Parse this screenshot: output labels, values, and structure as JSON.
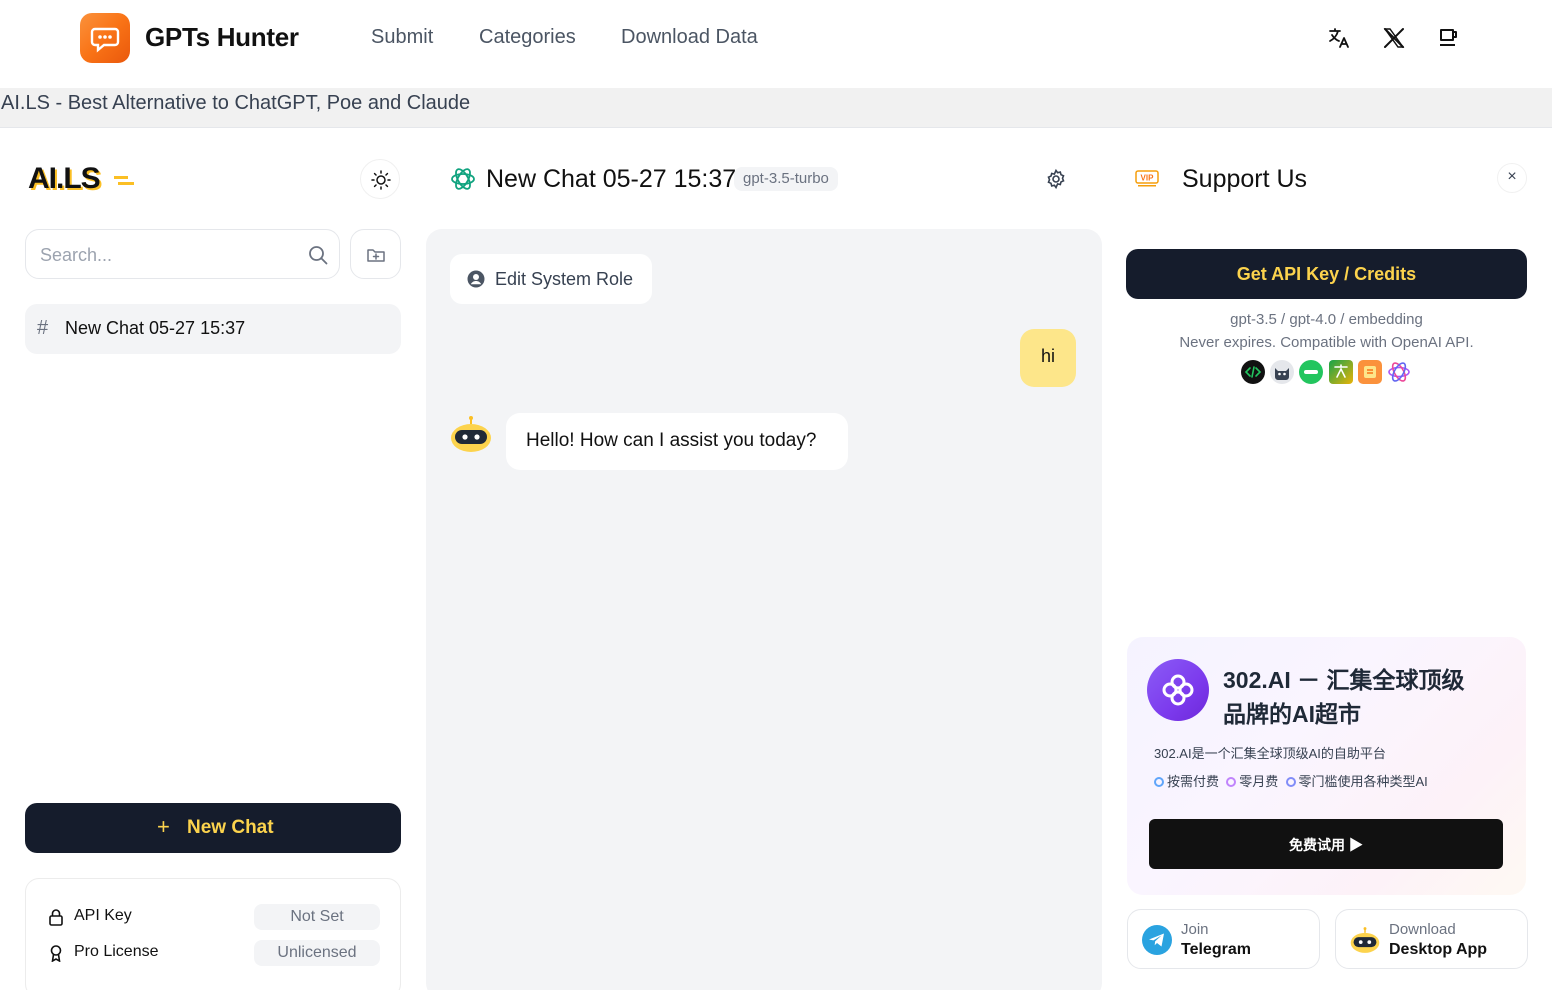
{
  "topnav": {
    "brand": "GPTs Hunter",
    "links": [
      "Submit",
      "Categories",
      "Download Data"
    ],
    "icons": [
      "translate-icon",
      "x-twitter-icon",
      "coffee-icon"
    ]
  },
  "subbar": {
    "title": "AI.LS - Best Alternative to ChatGPT, Poe and Claude"
  },
  "sidebar": {
    "logo": "AI.LS",
    "search": {
      "placeholder": "Search...",
      "value": ""
    },
    "chats": [
      {
        "label": "New Chat 05-27 15:37",
        "prefix": "#"
      }
    ],
    "new_chat_plus": "+",
    "new_chat_label": "New Chat",
    "license": {
      "api_key": {
        "label": "API Key",
        "value": "Not Set"
      },
      "pro_license": {
        "label": "Pro License",
        "value": "Unlicensed"
      }
    }
  },
  "chat": {
    "title": "New Chat 05-27 15:37",
    "model": "gpt-3.5-turbo",
    "system_role_label": "Edit System Role",
    "messages": [
      {
        "role": "user",
        "text": "hi"
      },
      {
        "role": "assistant",
        "text": "Hello! How can I assist you today?"
      }
    ]
  },
  "support": {
    "vip_badge": "VIP",
    "title": "Support Us",
    "close_label": "×",
    "api_button": "Get API Key / Credits",
    "api_models": "gpt-3.5 / gpt-4.0 / embedding",
    "api_note": "Never expires. Compatible with OpenAI API.",
    "brand_icons": [
      "code-app-icon",
      "cat-app-icon",
      "chat-app-icon",
      "translate-app-icon",
      "book-app-icon",
      "openai-icon"
    ],
    "ad": {
      "title_line1": "302.AI － 汇集全球顶级",
      "title_line2": "品牌的AI超市",
      "desc": "302.AI是一个汇集全球顶级AI的自助平台",
      "features": [
        "按需付费",
        "零月费",
        "零门槛使用各种类型AI"
      ],
      "feature_colors": [
        "#60a5fa",
        "#c084fc",
        "#818cf8"
      ],
      "button": "免费试用 ▶"
    },
    "telegram": {
      "line1": "Join",
      "line2": "Telegram"
    },
    "desktop": {
      "line1": "Download",
      "line2": "Desktop App"
    }
  },
  "colors": {
    "accent": "#fcd34d",
    "dark_button": "#151c2c",
    "user_bubble": "#fde68a",
    "brand_orange": "#f97316"
  }
}
